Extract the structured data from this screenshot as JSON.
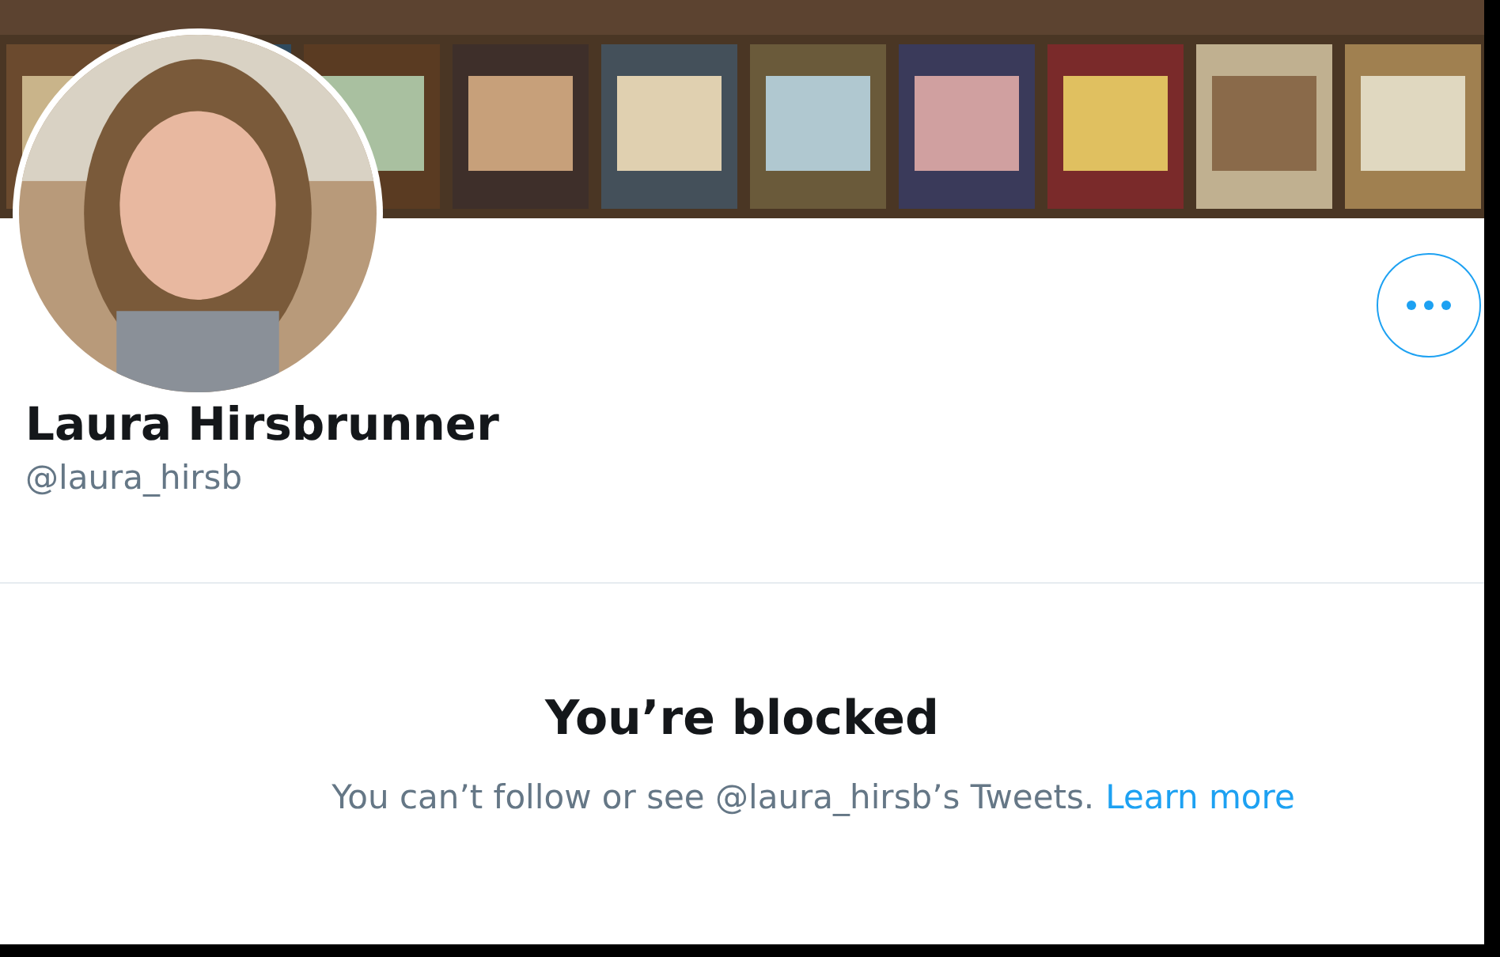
{
  "profile": {
    "name": "Laura Hirsbrunner",
    "handle": "@laura_hirsb"
  },
  "blocked": {
    "title": "You’re blocked",
    "message": "You can’t follow or see @laura_hirsb’s Tweets.",
    "link": "Learn more"
  }
}
